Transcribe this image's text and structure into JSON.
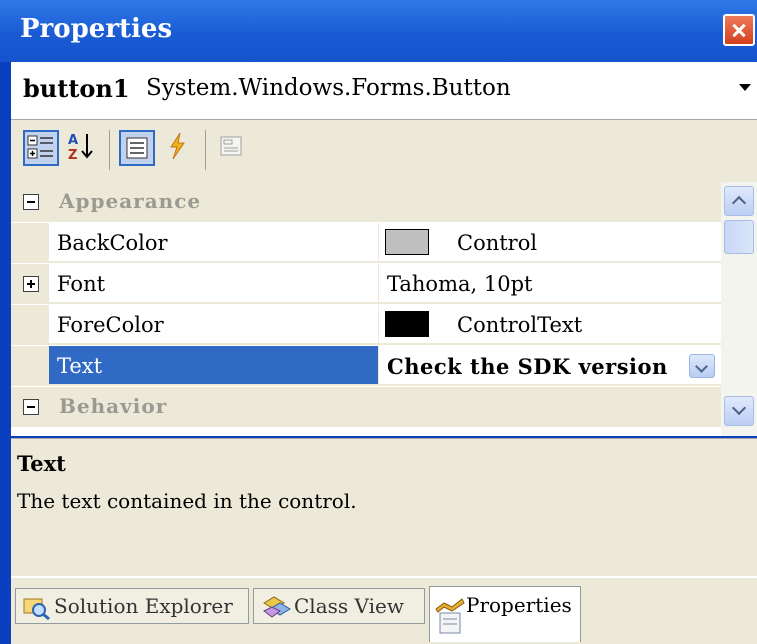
{
  "window": {
    "title": "Properties"
  },
  "object_selector": {
    "name": "button1",
    "type": "System.Windows.Forms.Button"
  },
  "toolbar": {
    "buttons": [
      {
        "icon": "categorized-icon",
        "pressed": true
      },
      {
        "icon": "alphabetical-sort-icon",
        "pressed": false
      },
      {
        "icon": "properties-view-icon",
        "pressed": true
      },
      {
        "icon": "events-lightning-icon",
        "pressed": false
      },
      {
        "icon": "property-pages-icon",
        "pressed": false,
        "disabled": true
      }
    ]
  },
  "grid": {
    "categories": [
      {
        "label": "Appearance",
        "expanded": true,
        "properties": [
          {
            "name": "BackColor",
            "value": "Control",
            "swatch": "#c0c0c0"
          },
          {
            "name": "Font",
            "value": "Tahoma, 10pt",
            "expandable": true
          },
          {
            "name": "ForeColor",
            "value": "ControlText",
            "swatch": "#000000"
          },
          {
            "name": "Text",
            "value": "Check the SDK version",
            "selected": true
          }
        ]
      },
      {
        "label": "Behavior",
        "expanded": true,
        "properties": []
      }
    ]
  },
  "description": {
    "title": "Text",
    "text": "The text contained in the control."
  },
  "tabs": [
    {
      "label": "Solution Explorer",
      "icon": "solution-explorer-icon",
      "active": false
    },
    {
      "label": "Class View",
      "icon": "class-view-icon",
      "active": false
    },
    {
      "label": "Properties",
      "icon": "properties-icon",
      "active": true
    }
  ],
  "colors": {
    "title_bar": "#1a5bd4",
    "frame": "#0a3fbf",
    "selection": "#316ac5",
    "panel_background": "#ece9d8"
  }
}
